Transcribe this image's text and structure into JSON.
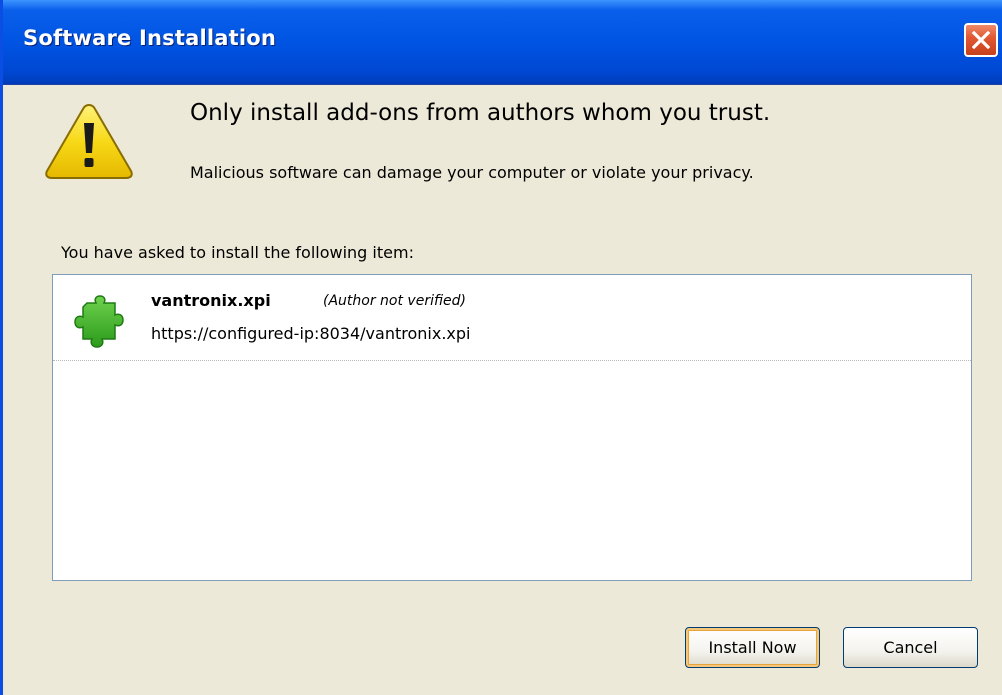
{
  "window": {
    "title": "Software Installation",
    "close_icon": "close-icon"
  },
  "warning": {
    "icon": "warning-icon",
    "heading": "Only install add-ons from authors whom you trust.",
    "description": "Malicious software can damage your computer or violate your privacy."
  },
  "list": {
    "caption": "You have asked to install the following item:",
    "items": [
      {
        "icon": "puzzle-piece-icon",
        "name": "vantronix.xpi",
        "note": "(Author not verified)",
        "url": "https://configured-ip:8034/vantronix.xpi"
      }
    ]
  },
  "buttons": {
    "install": "Install Now",
    "cancel": "Cancel"
  },
  "colors": {
    "titlebar": "#0054e3",
    "dialog_bg": "#ece9d8",
    "close_button": "#e25a35",
    "puzzle_green": "#3cae27",
    "warning_yellow": "#f5d20a"
  }
}
